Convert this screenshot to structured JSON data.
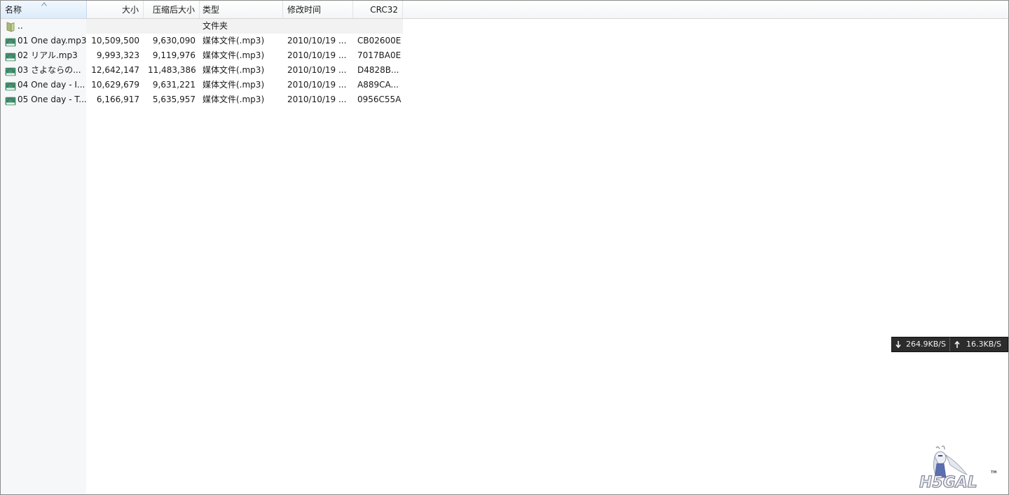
{
  "columns": {
    "name": "名称",
    "size": "大小",
    "packed": "压缩后大小",
    "type": "类型",
    "modified": "修改时间",
    "crc": "CRC32"
  },
  "rows": [
    {
      "name": "..",
      "size": "",
      "packed": "",
      "type": "文件夹",
      "modified": "",
      "crc": "",
      "icon": "folder-icon"
    },
    {
      "name": "01 One day.mp3",
      "size": "10,509,500",
      "packed": "9,630,090",
      "type": "媒体文件(.mp3)",
      "modified": "2010/10/19 ...",
      "crc": "CB02600E",
      "icon": "mp3-file-icon"
    },
    {
      "name": "02 リアル.mp3",
      "size": "9,993,323",
      "packed": "9,119,976",
      "type": "媒体文件(.mp3)",
      "modified": "2010/10/19 ...",
      "crc": "7017BA0E",
      "icon": "mp3-file-icon"
    },
    {
      "name": "03 さよならの...",
      "size": "12,642,147",
      "packed": "11,483,386",
      "type": "媒体文件(.mp3)",
      "modified": "2010/10/19 ...",
      "crc": "D4828B...",
      "icon": "mp3-file-icon"
    },
    {
      "name": "04 One day - I...",
      "size": "10,629,679",
      "packed": "9,631,221",
      "type": "媒体文件(.mp3)",
      "modified": "2010/10/19 ...",
      "crc": "A889CA...",
      "icon": "mp3-file-icon"
    },
    {
      "name": "05 One day - T...",
      "size": "6,166,917",
      "packed": "5,635,957",
      "type": "媒体文件(.mp3)",
      "modified": "2010/10/19 ...",
      "crc": "0956C55A",
      "icon": "mp3-file-icon"
    }
  ],
  "network": {
    "download": "264.9KB/S",
    "upload": "16.3KB/S"
  },
  "watermark": {
    "logo_text": "H5GAL",
    "tm": "TM"
  },
  "colors": {
    "sorted_header": "#dcecfc",
    "name_column_bg": "#f6f7f8",
    "net_widget_bg": "#2c2c2c"
  }
}
